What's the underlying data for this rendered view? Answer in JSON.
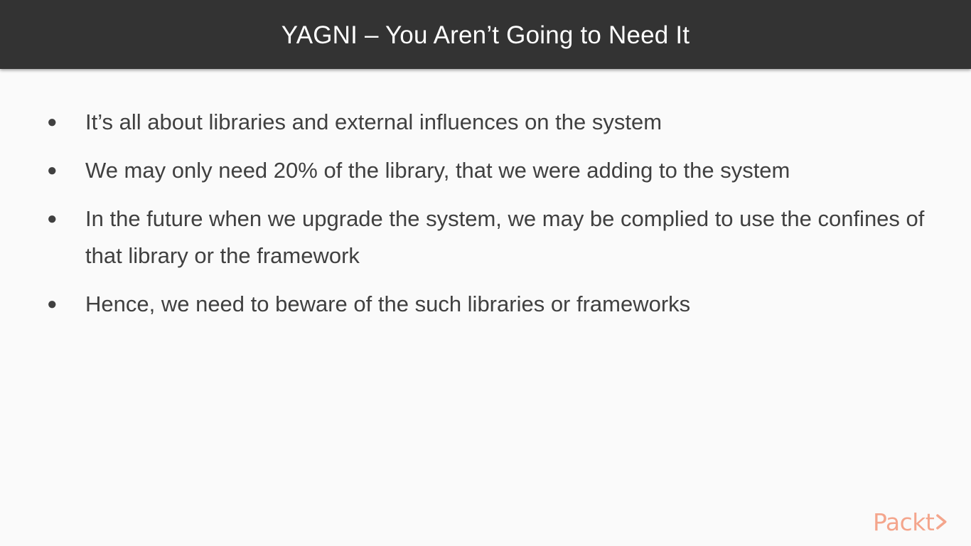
{
  "slide": {
    "title": "YAGNI – You Aren’t Going to Need It",
    "bullets": [
      "It’s all about libraries and external influences on the system",
      "We may only need 20% of the library, that we were adding to the system",
      "In the future when we upgrade the system, we may be complied to use the confines of that library or the framework",
      "Hence, we need to beware of the such libraries or frameworks"
    ],
    "bullet_glyph": "●",
    "logo": {
      "text": "Packt",
      "icon": "chevron-right-icon",
      "color": "#f4a58c"
    },
    "colors": {
      "title_bar": "#333333",
      "title_text": "#ffffff",
      "body_text": "#404040",
      "background": "#fafafa"
    }
  }
}
